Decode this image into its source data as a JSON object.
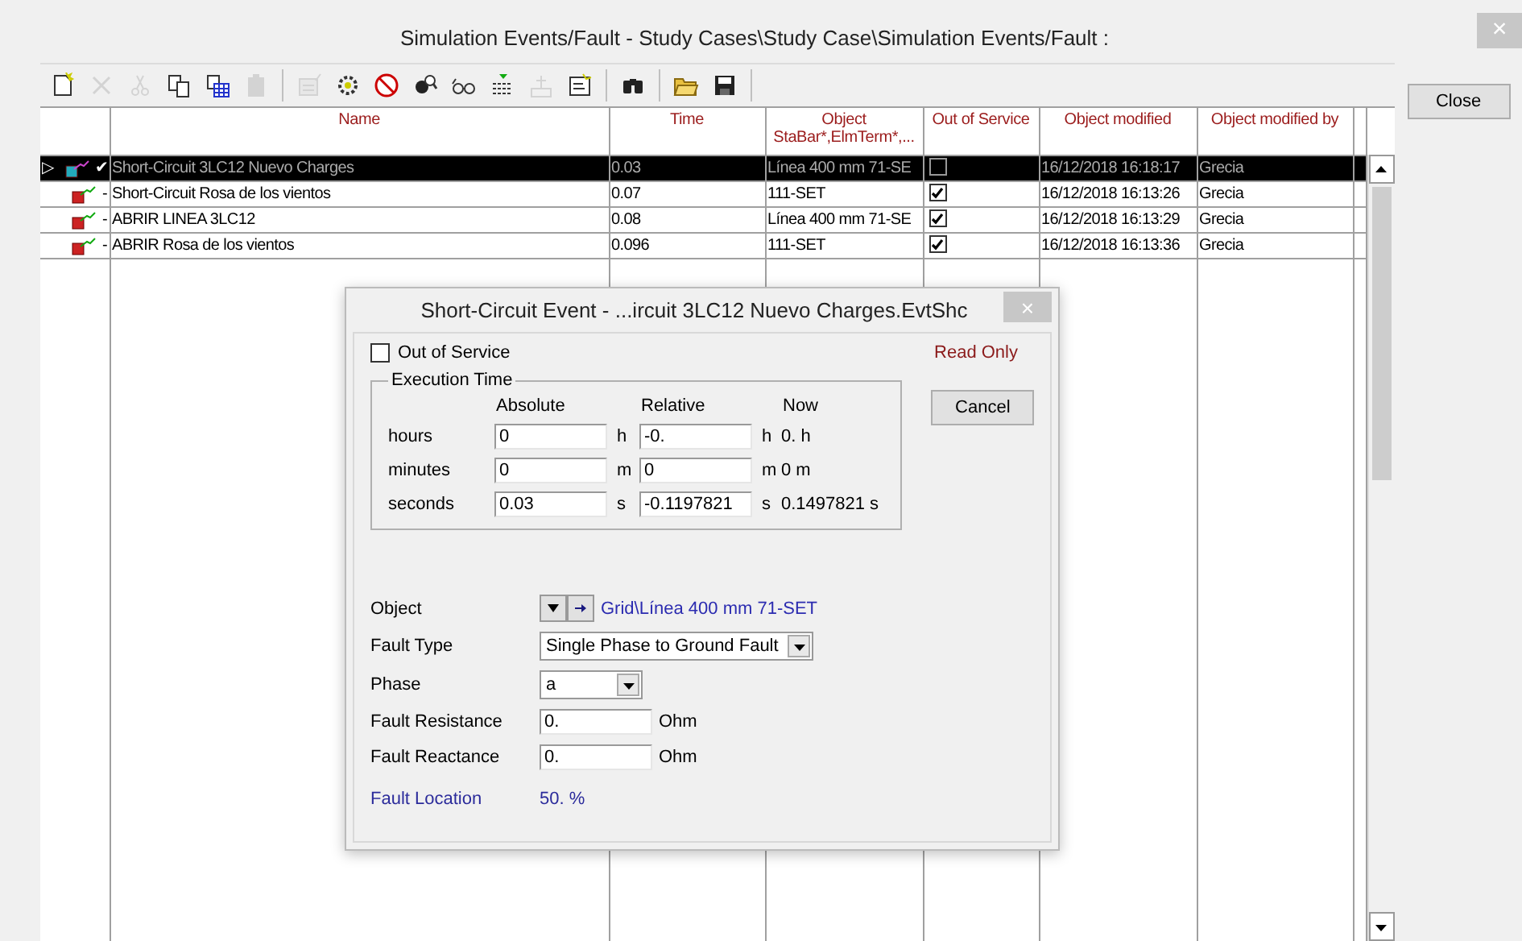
{
  "window": {
    "title": "Simulation Events/Fault - Study Cases\\Study Case\\Simulation Events/Fault :",
    "close": "×"
  },
  "toolbar": [
    {
      "kind": "new",
      "disabled": false
    },
    {
      "kind": "delete",
      "disabled": true
    },
    {
      "kind": "cut",
      "disabled": true
    },
    {
      "kind": "copy",
      "disabled": false
    },
    {
      "kind": "table",
      "disabled": false
    },
    {
      "kind": "paste",
      "disabled": true
    },
    {
      "kind": "sep"
    },
    {
      "kind": "edit",
      "disabled": true
    },
    {
      "kind": "gear",
      "disabled": false
    },
    {
      "kind": "forbid",
      "disabled": false
    },
    {
      "kind": "inspect",
      "disabled": false
    },
    {
      "kind": "glasses",
      "disabled": false
    },
    {
      "kind": "filter",
      "disabled": false
    },
    {
      "kind": "tree",
      "disabled": true
    },
    {
      "kind": "note",
      "disabled": false
    },
    {
      "kind": "sep"
    },
    {
      "kind": "binoculars",
      "disabled": false
    },
    {
      "kind": "sep"
    },
    {
      "kind": "folder",
      "disabled": false
    },
    {
      "kind": "save",
      "disabled": false
    },
    {
      "kind": "sep"
    }
  ],
  "side_button": "Close",
  "table": {
    "columns": [
      {},
      {
        "label": "Name"
      },
      {
        "label": "Time"
      },
      {
        "label": "Object",
        "sub": "StaBar*,ElmTerm*,..."
      },
      {
        "label": "Out of Service"
      },
      {
        "label": "Object modified"
      },
      {
        "label": "Object modified by"
      },
      {}
    ],
    "rows": [
      {
        "selected": true,
        "pointer": "▷",
        "mark": "✔",
        "name": "Short-Circuit 3LC12 Nuevo Charges",
        "time": "0.03",
        "object": "Línea 400 mm 71-SE",
        "out_of_service": false,
        "modified": "16/12/2018 16:18:17",
        "modified_by": "Grecia"
      },
      {
        "selected": false,
        "pointer": "",
        "mark": "-",
        "name": "Short-Circuit Rosa de los vientos",
        "time": "0.07",
        "object": "111-SET",
        "out_of_service": true,
        "modified": "16/12/2018 16:13:26",
        "modified_by": "Grecia"
      },
      {
        "selected": false,
        "pointer": "",
        "mark": "-",
        "name": "ABRIR LINEA 3LC12",
        "time": "0.08",
        "object": "Línea 400 mm 71-SE",
        "out_of_service": true,
        "modified": "16/12/2018 16:13:29",
        "modified_by": "Grecia"
      },
      {
        "selected": false,
        "pointer": "",
        "mark": "-",
        "name": "ABRIR Rosa de los vientos",
        "time": "0.096",
        "object": "111-SET",
        "out_of_service": true,
        "modified": "16/12/2018 16:13:36",
        "modified_by": "Grecia"
      }
    ]
  },
  "dialog": {
    "title": "Short-Circuit Event - ...ircuit 3LC12 Nuevo Charges.EvtShc",
    "close": "×",
    "out_of_service": {
      "label": "Out of Service",
      "checked": false
    },
    "read_only": "Read Only",
    "cancel": "Cancel",
    "execution_time": {
      "title": "Execution Time",
      "headers": [
        "Absolute",
        "Relative",
        "Now"
      ],
      "rows": [
        {
          "label": "hours",
          "absolute": "0",
          "abs_unit": "h",
          "relative": "-0.",
          "rel_unit": "h",
          "now": "0. h"
        },
        {
          "label": "minutes",
          "absolute": "0",
          "abs_unit": "m",
          "relative": "0",
          "rel_unit": "m",
          "now": "0 m"
        },
        {
          "label": "seconds",
          "absolute": "0.03",
          "abs_unit": "s",
          "relative": "-0.1197821",
          "rel_unit": "s",
          "now": "0.1497821 s"
        }
      ]
    },
    "object": {
      "label": "Object",
      "value": "Grid\\Línea 400 mm 71-SET"
    },
    "fault_type": {
      "label": "Fault Type",
      "value": "Single Phase to Ground Fault"
    },
    "phase": {
      "label": "Phase",
      "value": "a"
    },
    "fault_resistance": {
      "label": "Fault Resistance",
      "value": "0.",
      "unit": "Ohm"
    },
    "fault_reactance": {
      "label": "Fault Reactance",
      "value": "0.",
      "unit": "Ohm"
    },
    "fault_location": {
      "label": "Fault Location",
      "value": "50. %"
    }
  }
}
